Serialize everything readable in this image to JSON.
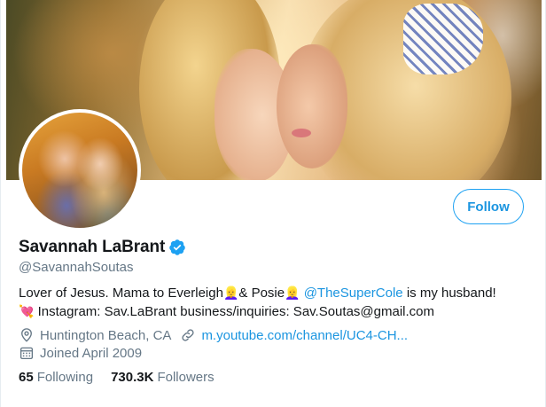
{
  "profile": {
    "display_name": "Savannah LaBrant",
    "handle": "@SavannahSoutas",
    "verified": true
  },
  "actions": {
    "follow_label": "Follow"
  },
  "bio": {
    "line1_a": "Lover of Jesus. Mama to Everleigh",
    "line1_b": "& Posie",
    "mention": "@TheSuperCole",
    "line1_c": "is my husband!",
    "line2": "Instagram: Sav.LaBrant business/inquiries: Sav.Soutas@gmail.com",
    "emoji_person": "👱‍♀️",
    "emoji_heart": "💘"
  },
  "meta": {
    "location": "Huntington Beach, CA",
    "website": "m.youtube.com/channel/UC4-CH...",
    "joined": "Joined April 2009"
  },
  "stats": {
    "following_count": "65",
    "following_label": "Following",
    "followers_count": "730.3K",
    "followers_label": "Followers"
  },
  "colors": {
    "accent": "#1da1f2",
    "link": "#1b95e0",
    "muted": "#657786",
    "text": "#14171a"
  }
}
